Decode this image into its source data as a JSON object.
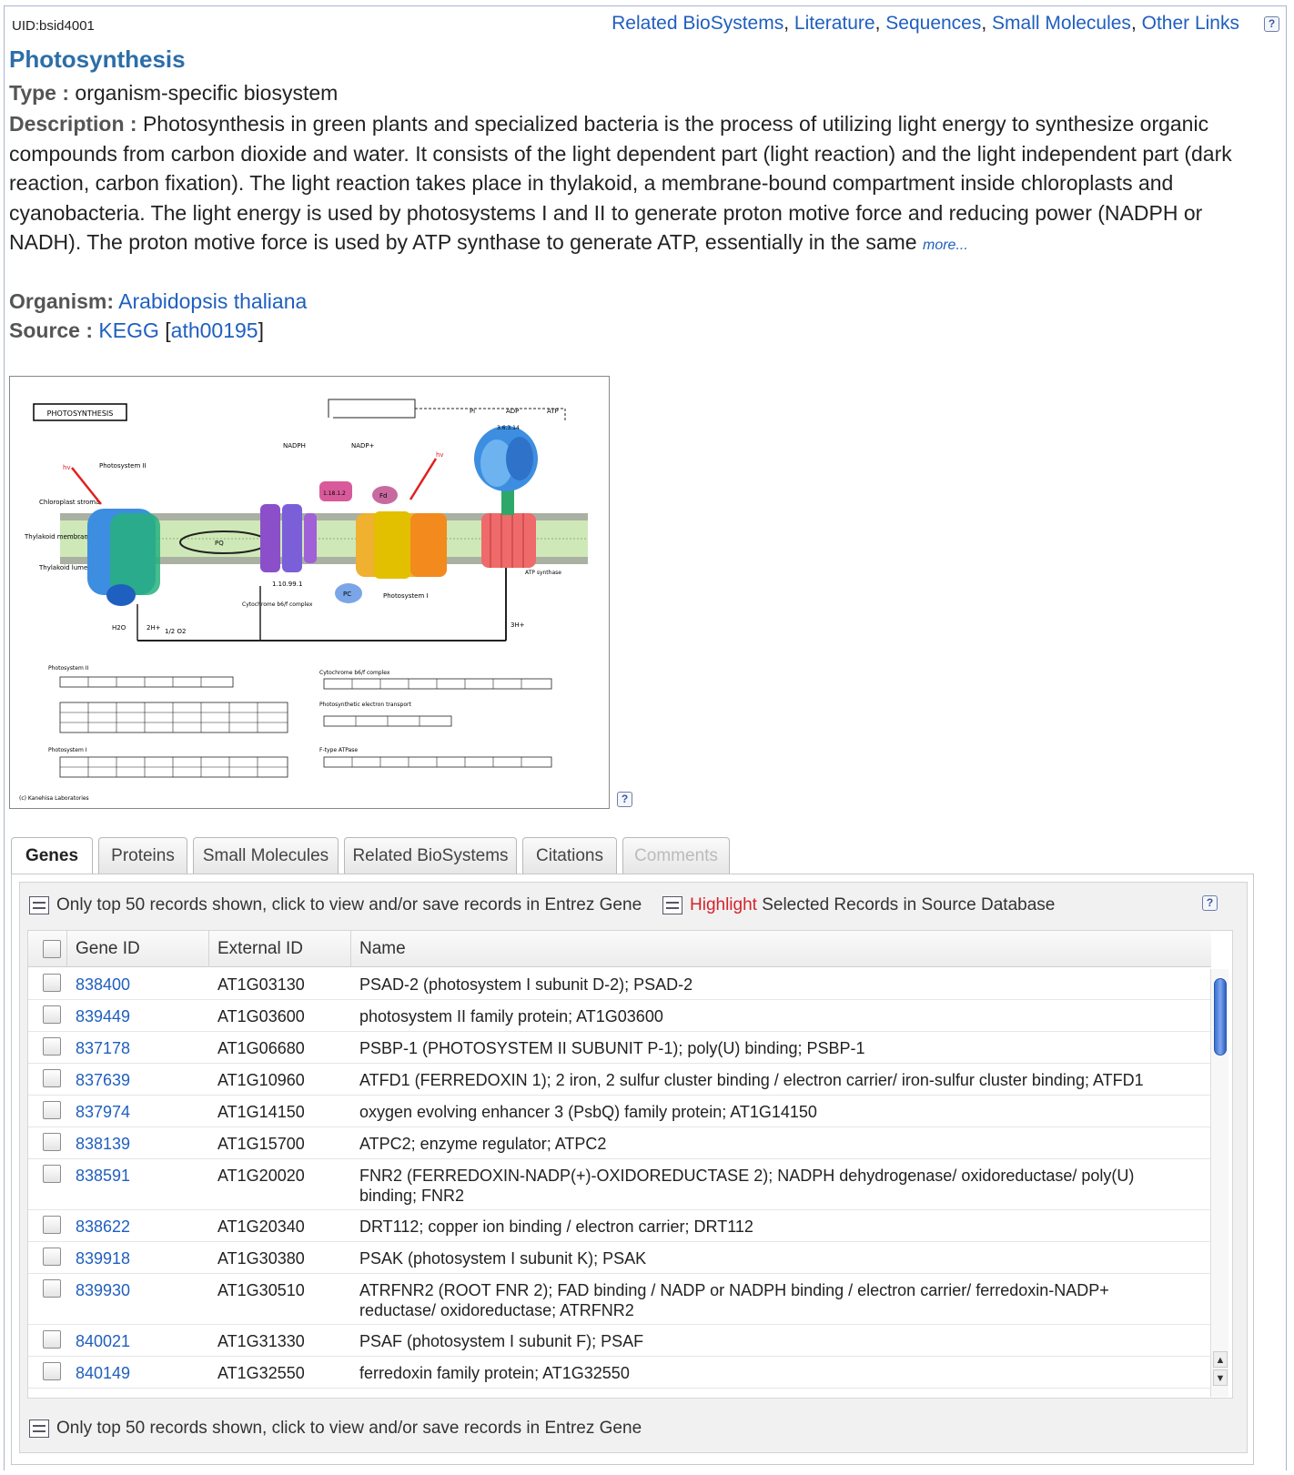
{
  "uid": "UID:bsid4001",
  "top_links": [
    "Related BioSystems",
    "Literature",
    "Sequences",
    "Small Molecules",
    "Other Links"
  ],
  "title": "Photosynthesis",
  "type_label": "Type :",
  "type_value": "organism-specific biosystem",
  "description_label": "Description :",
  "description_text": "Photosynthesis in green plants and specialized bacteria is the process of utilizing light energy to synthesize organic compounds from carbon dioxide and water. It consists of the light dependent part (light reaction) and the light independent part (dark reaction, carbon fixation). The light reaction takes place in thylakoid, a membrane-bound compartment inside chloroplasts and cyanobacteria. The light energy is used by photosystems I and II to generate proton motive force and reducing power (NADPH or NADH). The proton motive force is used by ATP synthase to generate ATP, essentially in the same",
  "more_label": "more...",
  "organism_label": "Organism:",
  "organism_value": "Arabidopsis thaliana",
  "source_label": "Source :",
  "source_db": "KEGG",
  "source_id": "ath00195",
  "diagram": {
    "title": "PHOTOSYNTHESIS",
    "labels": {
      "nadph": "NADPH",
      "nadp": "NADP+",
      "atp": "ATP",
      "adp": "ADP",
      "pi": "Pi",
      "hv1": "hv",
      "hv2": "hv",
      "psii": "Photosystem II",
      "psi": "Photosystem I",
      "cytb6f": "Cytochrome b6/f complex",
      "atpsyn": "ATP synthase",
      "ec1": "1.18.1.2",
      "ec2": "1.10.99.1",
      "ec3": "3.6.3.14",
      "pc": "PC",
      "fd": "Fd",
      "pq": "PQ",
      "stroma": "Chloroplast stroma",
      "membrane": "Thylakoid membrane",
      "lumen": "Thylakoid lumen",
      "h_lumen": "2H+",
      "h_stroma": "3H+",
      "h2o": "H2O",
      "o2": "1/2 O2",
      "sec_psii": "Photosystem II",
      "sec_cyt": "Cytochrome b6/f complex",
      "sec_pet": "Photosynthetic electron transport",
      "sec_psi": "Photosystem I",
      "sec_atp": "F-type ATPase",
      "copyright": "(c) Kanehisa Laboratories"
    }
  },
  "tabs": [
    {
      "label": "Genes",
      "active": true,
      "disabled": false
    },
    {
      "label": "Proteins",
      "active": false,
      "disabled": false
    },
    {
      "label": "Small Molecules",
      "active": false,
      "disabled": false
    },
    {
      "label": "Related BioSystems",
      "active": false,
      "disabled": false
    },
    {
      "label": "Citations",
      "active": false,
      "disabled": false
    },
    {
      "label": "Comments",
      "active": false,
      "disabled": true
    }
  ],
  "toolbar": {
    "view_label": "Only top 50 records shown, click to view and/or save records in Entrez Gene",
    "highlight_word": "Highlight",
    "highlight_rest": " Selected Records in Source Database"
  },
  "table": {
    "headers": [
      "Gene ID",
      "External ID",
      "Name"
    ],
    "rows": [
      {
        "gene_id": "838400",
        "external_id": "AT1G03130",
        "name": "PSAD-2 (photosystem I subunit D-2); PSAD-2"
      },
      {
        "gene_id": "839449",
        "external_id": "AT1G03600",
        "name": "photosystem II family protein; AT1G03600"
      },
      {
        "gene_id": "837178",
        "external_id": "AT1G06680",
        "name": "PSBP-1 (PHOTOSYSTEM II SUBUNIT P-1); poly(U) binding; PSBP-1"
      },
      {
        "gene_id": "837639",
        "external_id": "AT1G10960",
        "name": "ATFD1 (FERREDOXIN 1); 2 iron, 2 sulfur cluster binding / electron carrier/ iron-sulfur cluster binding; ATFD1"
      },
      {
        "gene_id": "837974",
        "external_id": "AT1G14150",
        "name": "oxygen evolving enhancer 3 (PsbQ) family protein; AT1G14150"
      },
      {
        "gene_id": "838139",
        "external_id": "AT1G15700",
        "name": "ATPC2; enzyme regulator; ATPC2"
      },
      {
        "gene_id": "838591",
        "external_id": "AT1G20020",
        "name": "FNR2 (FERREDOXIN-NADP(+)-OXIDOREDUCTASE 2); NADPH dehydrogenase/ oxidoreductase/ poly(U) binding; FNR2"
      },
      {
        "gene_id": "838622",
        "external_id": "AT1G20340",
        "name": "DRT112; copper ion binding / electron carrier; DRT112"
      },
      {
        "gene_id": "839918",
        "external_id": "AT1G30380",
        "name": "PSAK (photosystem I subunit K); PSAK"
      },
      {
        "gene_id": "839930",
        "external_id": "AT1G30510",
        "name": "ATRFNR2 (ROOT FNR 2); FAD binding / NADP or NADPH binding / electron carrier/ ferredoxin-NADP+ reductase/ oxidoreductase; ATRFNR2"
      },
      {
        "gene_id": "840021",
        "external_id": "AT1G31330",
        "name": "PSAF (photosystem I subunit F); PSAF"
      },
      {
        "gene_id": "840149",
        "external_id": "AT1G32550",
        "name": "ferredoxin family protein; AT1G32550"
      }
    ]
  },
  "footer_label": "Only top 50 records shown, click to view and/or save records in Entrez Gene",
  "help_glyph": "?",
  "colors": {
    "link": "#1f5fbf",
    "title": "#2c6ea9",
    "highlight": "#d6232a",
    "scroll_thumb": "#3a6fd0"
  }
}
